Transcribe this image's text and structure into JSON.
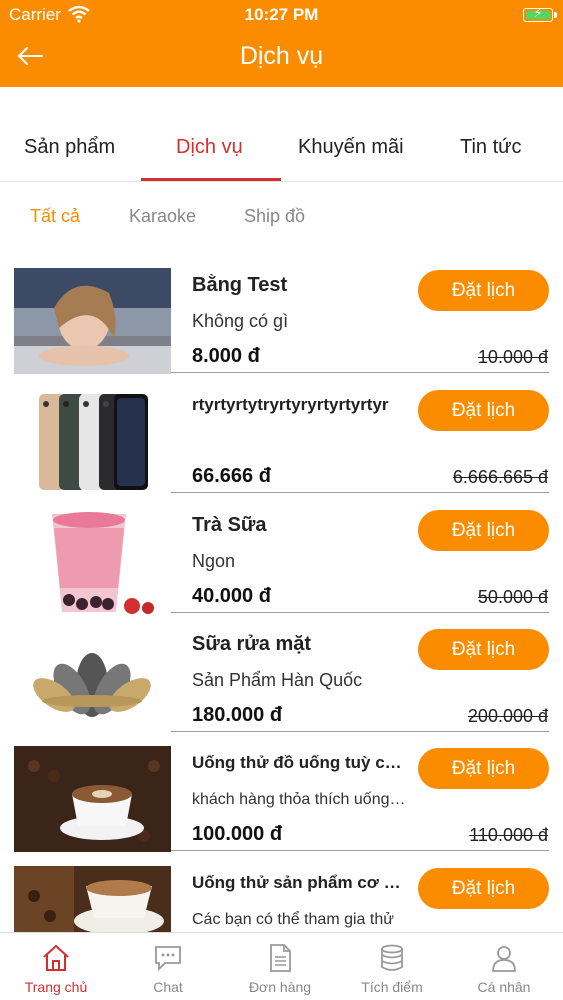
{
  "status": {
    "carrier": "Carrier",
    "time": "10:27 PM"
  },
  "header": {
    "title": "Dịch vụ"
  },
  "tabs": [
    {
      "label": "Sản phẩm",
      "active": false
    },
    {
      "label": "Dịch vụ",
      "active": true
    },
    {
      "label": "Khuyến mãi",
      "active": false
    },
    {
      "label": "Tin tức",
      "active": false
    }
  ],
  "filters": [
    {
      "label": "Tất cả",
      "active": true
    },
    {
      "label": "Karaoke",
      "active": false
    },
    {
      "label": "Ship đồ",
      "active": false
    }
  ],
  "button_label": "Đặt lịch",
  "items": [
    {
      "name": "Bằng Test",
      "desc": "Không có gì",
      "price": "8.000 đ",
      "old_price": "10.000 đ",
      "image": "portrait-photo"
    },
    {
      "name": "rtyrtyrtytryrtyryrtyrtyrtyr",
      "desc": "",
      "price": "66.666 đ",
      "old_price": "6.666.665 đ",
      "image": "smartphones-photo"
    },
    {
      "name": "Trà Sữa",
      "desc": "Ngon",
      "price": "40.000 đ",
      "old_price": "50.000 đ",
      "image": "milk-tea-photo"
    },
    {
      "name": "Sữa rửa mặt",
      "desc": "Sản Phẩm Hàn Quốc",
      "price": "180.000 đ",
      "old_price": "200.000 đ",
      "image": "lotus-logo"
    },
    {
      "name": "Uống thử đồ uống tuỳ chọn",
      "desc": "khách hàng thỏa thích uống thử",
      "price": "100.000 đ",
      "old_price": "110.000 đ",
      "image": "coffee-beans-photo"
    },
    {
      "name": "Uống thử sản phẩm cơ bản",
      "desc": "Các bạn có thể tham gia thử",
      "price": "",
      "old_price": "",
      "image": "coffee-cup-photo"
    }
  ],
  "tabbar": [
    {
      "label": "Trang chủ",
      "icon": "home-icon",
      "active": true
    },
    {
      "label": "Chat",
      "icon": "chat-icon",
      "active": false
    },
    {
      "label": "Đơn hàng",
      "icon": "document-icon",
      "active": false
    },
    {
      "label": "Tích điểm",
      "icon": "database-icon",
      "active": false
    },
    {
      "label": "Cá nhân",
      "icon": "user-icon",
      "active": false
    }
  ],
  "colors": {
    "brand": "#fb8c00",
    "accent": "#d32f2f"
  }
}
